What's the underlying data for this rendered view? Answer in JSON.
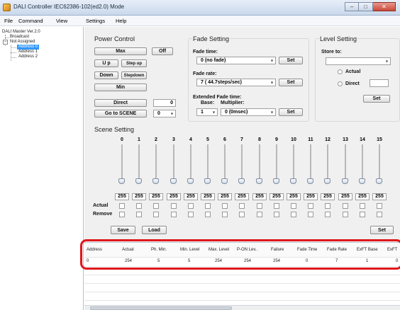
{
  "window": {
    "title": "DALI Controller IEC62386-102(ed2.0) Mode",
    "minimize": "–",
    "maximize": "□",
    "close": "✕"
  },
  "menu": [
    "File",
    "Command",
    "View",
    "Settings",
    "Help"
  ],
  "tree": {
    "root": "DALI Master Ver.2.0",
    "broadcast": "Broadcast",
    "not_assigned": "Not Assigned",
    "addresses": [
      "Address 0",
      "Address 1",
      "Address 2"
    ],
    "expander": "–"
  },
  "power_control": {
    "title": "Power Control",
    "max": "Max",
    "off": "Off",
    "up": "U p",
    "step_up": "Step up",
    "down": "Down",
    "step_down": "Stepdown",
    "min": "Min",
    "direct": "Direct",
    "direct_value": "0",
    "go_to_scene": "Go to SCENE",
    "scene_value": "0"
  },
  "fade_setting": {
    "title": "Fade Setting",
    "fade_time_label": "Fade time:",
    "fade_time_value": "0 (no fade)",
    "fade_rate_label": "Fade rate:",
    "fade_rate_value": "7 ( 44.7steps/sec)",
    "ext_label": "Extended Fade time:",
    "base_label": "Base:",
    "multiplier_label": "Multiplier:",
    "base_value": "1",
    "multiplier_value": "0 (0msec)",
    "set": "Set"
  },
  "level_setting": {
    "title": "Level Setting",
    "store_to": "Store to:",
    "store_value": "",
    "actual": "Actual",
    "direct": "Direct",
    "direct_value": "",
    "set": "Set"
  },
  "scene_setting": {
    "title": "Scene Setting",
    "scenes": [
      "0",
      "1",
      "2",
      "3",
      "4",
      "5",
      "6",
      "7",
      "8",
      "9",
      "10",
      "11",
      "12",
      "13",
      "14",
      "15"
    ],
    "levels": [
      "255",
      "255",
      "255",
      "255",
      "255",
      "255",
      "255",
      "255",
      "255",
      "255",
      "255",
      "255",
      "255",
      "255",
      "255",
      "255"
    ],
    "actual_label": "Actual",
    "remove_label": "Remove",
    "save": "Save",
    "load": "Load",
    "set": "Set"
  },
  "grid": {
    "columns": [
      "Address",
      "Actual",
      "Ph. Min.",
      "Min. Level",
      "Max. Level",
      "P-ON Lev..",
      "Failure",
      "Fade Time",
      "Fade Rate",
      "ExFT Base",
      "ExFT"
    ],
    "rows": [
      [
        "0",
        "254",
        "5",
        "5",
        "254",
        "254",
        "254",
        "0",
        "7",
        "1",
        "0"
      ]
    ]
  },
  "icons": {
    "dropdown": "▾",
    "app": "app-icon"
  },
  "colors": {
    "selection": "#3399ff",
    "highlight_outline": "#e0161b"
  }
}
